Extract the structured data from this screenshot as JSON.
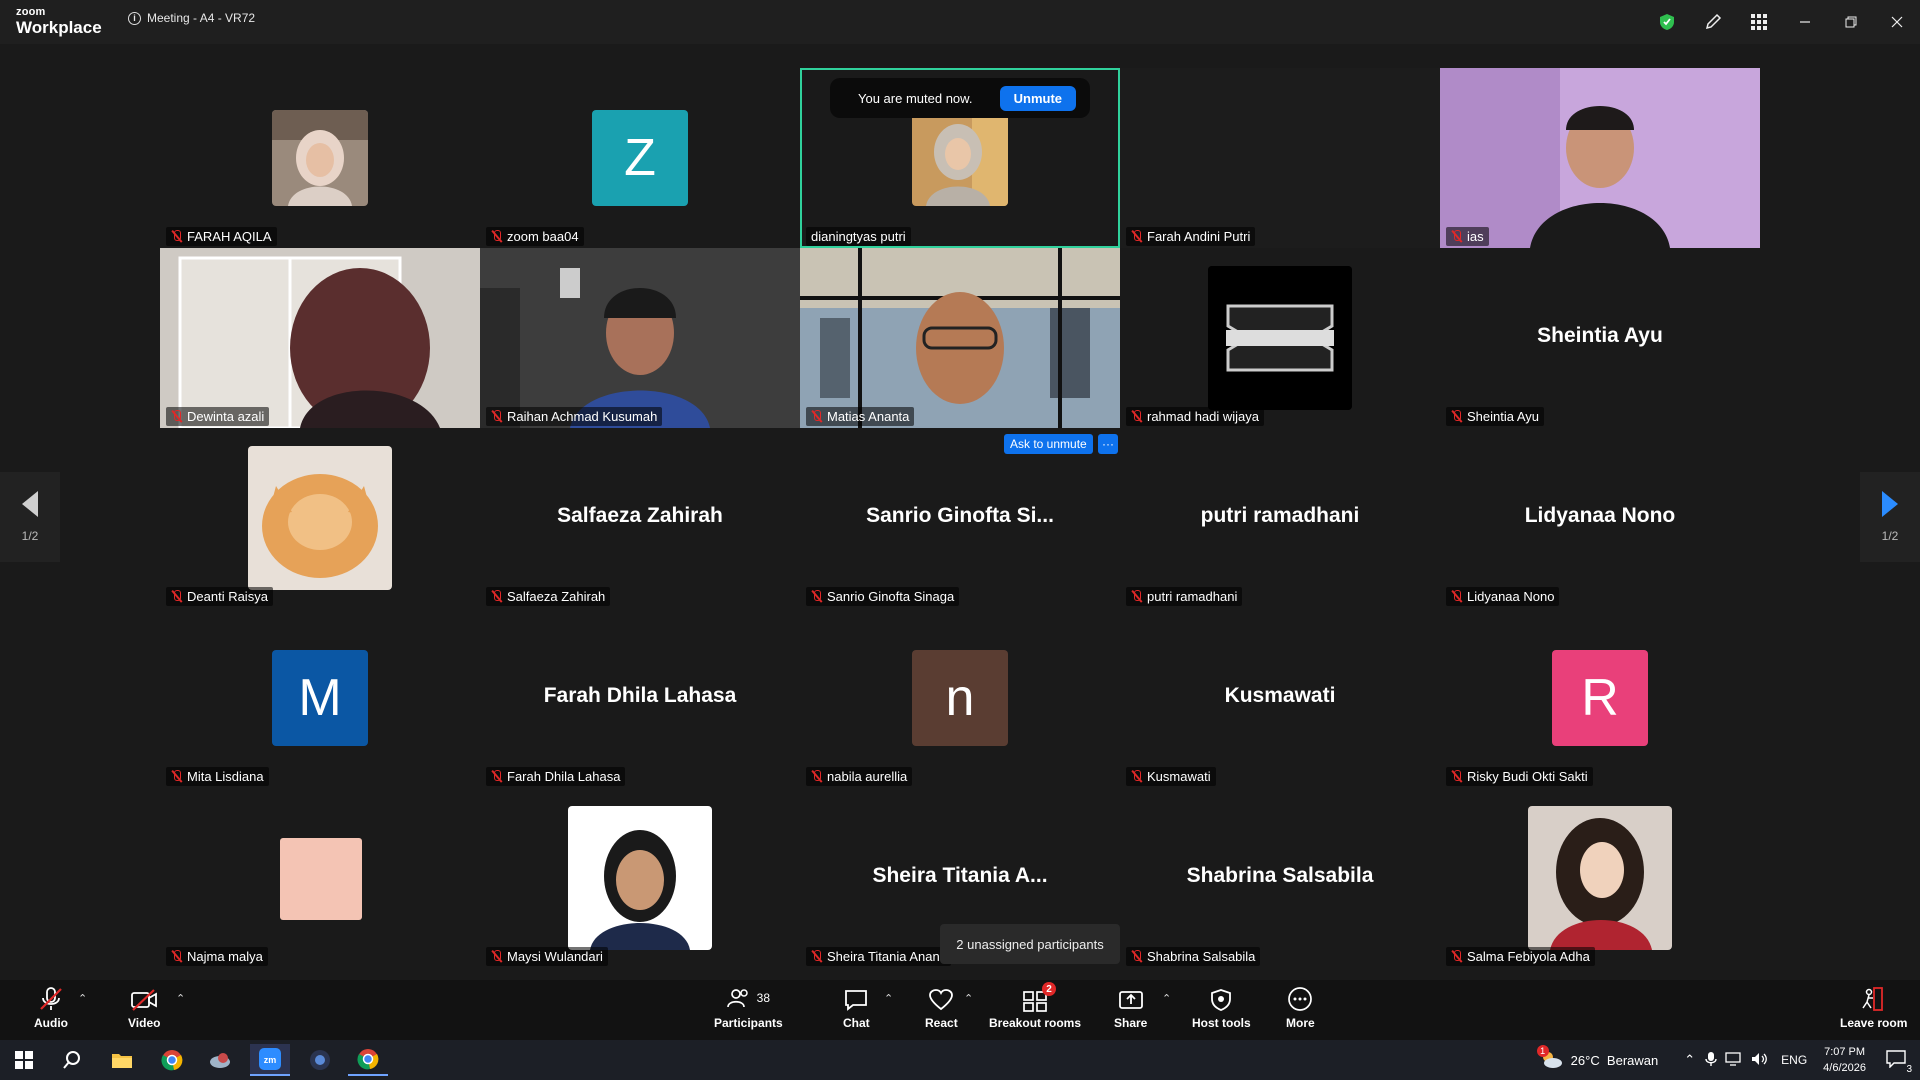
{
  "titlebar": {
    "logo_top": "zoom",
    "logo_bottom": "Workplace",
    "meeting_title": "Meeting - A4 - VR72"
  },
  "colors": {
    "accent": "#0e72ed",
    "active_border": "#30d19c",
    "muted_red": "#e02828",
    "shield_green": "#2fbf4f"
  },
  "toast": {
    "text": "You are muted now.",
    "button": "Unmute"
  },
  "tiles": [
    {
      "name": "FARAH AQILA",
      "kind": "photo"
    },
    {
      "name": "zoom baa04",
      "kind": "letter",
      "letter": "Z",
      "color": "#1aa1b0"
    },
    {
      "name": "dianingtyas putri",
      "kind": "photo",
      "active": true
    },
    {
      "name": "Farah Andini Putri",
      "kind": "blank"
    },
    {
      "name": "ias",
      "kind": "video"
    },
    {
      "name": "Dewinta azali",
      "kind": "video"
    },
    {
      "name": "Raihan Achmad Kusumah",
      "kind": "video"
    },
    {
      "name": "Matias Ananta",
      "kind": "video"
    },
    {
      "name": "rahmad hadi wijaya",
      "kind": "logo"
    },
    {
      "name": "Sheintia Ayu",
      "kind": "text",
      "display": "Sheintia Ayu"
    },
    {
      "name": "Deanti Raisya",
      "kind": "photo-big"
    },
    {
      "name": "Salfaeza Zahirah",
      "kind": "text",
      "display": "Salfaeza Zahirah"
    },
    {
      "name": "Sanrio Ginofta Sinaga",
      "kind": "text",
      "display": "Sanrio  Ginofta  Si..."
    },
    {
      "name": "putri ramadhani",
      "kind": "text",
      "display": "putri ramadhani"
    },
    {
      "name": "Lidyanaa Nono",
      "kind": "text",
      "display": "Lidyanaa Nono"
    },
    {
      "name": "Mita Lisdiana",
      "kind": "letter",
      "letter": "M",
      "color": "#0b57a4"
    },
    {
      "name": "Farah Dhila Lahasa",
      "kind": "text",
      "display": "Farah Dhila Lahasa"
    },
    {
      "name": "nabila aurellia",
      "kind": "letter",
      "letter": "n",
      "color": "#5a3d32"
    },
    {
      "name": "Kusmawati",
      "kind": "text",
      "display": "Kusmawati"
    },
    {
      "name": "Risky Budi Okti Sakti",
      "kind": "letter",
      "letter": "R",
      "color": "#e9407a"
    },
    {
      "name": "Najma malya",
      "kind": "swatch",
      "color": "#f4c4b4"
    },
    {
      "name": "Maysi Wulandari",
      "kind": "photo-big"
    },
    {
      "name": "Sheira Titania Ananc",
      "kind": "text",
      "display": "Sheira  Titania  A..."
    },
    {
      "name": "Shabrina Salsabila",
      "kind": "text",
      "display": "Shabrina Salsabila"
    },
    {
      "name": "Salma Febiyola Adha",
      "kind": "photo-big"
    }
  ],
  "overlays": {
    "ask_to_unmute": "Ask to unmute",
    "more_dots": "···",
    "unassigned": "2 unassigned participants"
  },
  "pagination": {
    "left": "1/2",
    "right": "1/2"
  },
  "toolbar": {
    "audio": "Audio",
    "video": "Video",
    "participants": "Participants",
    "participants_count": "38",
    "chat": "Chat",
    "react": "React",
    "breakout": "Breakout rooms",
    "breakout_badge": "2",
    "share": "Share",
    "host_tools": "Host tools",
    "more": "More",
    "leave": "Leave room"
  },
  "taskbar": {
    "weather": "26°C  Berawan",
    "lang": "ENG",
    "time": "7:07 PM",
    "date": "4/6/2026",
    "notif_count": "3",
    "weather_badge": "1"
  }
}
